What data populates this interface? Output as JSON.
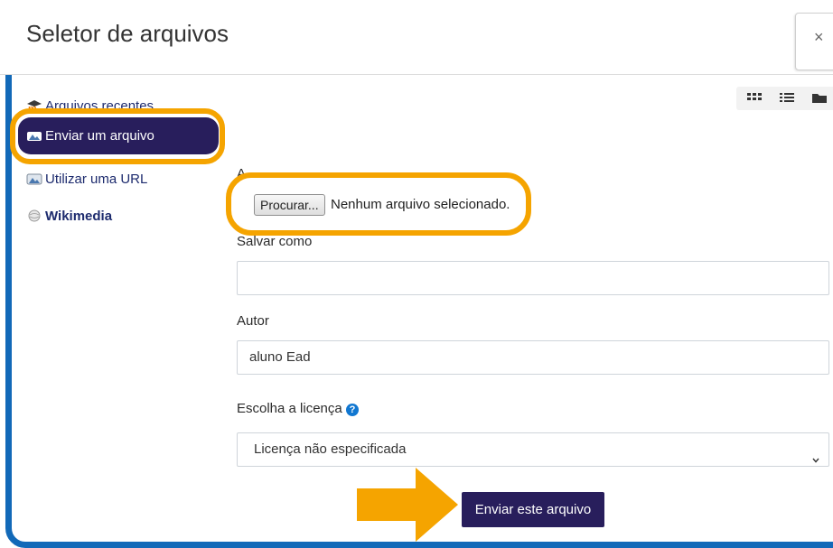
{
  "dialog": {
    "title": "Seletor de arquivos",
    "close_glyph": "×"
  },
  "sidebar": {
    "items": [
      {
        "label": "Arquivos recentes",
        "icon": "moodle-recent-icon"
      },
      {
        "label": "Enviar um arquivo",
        "icon": "upload-icon",
        "active": true
      },
      {
        "label": "Utilizar uma URL",
        "icon": "url-icon"
      },
      {
        "label": "Wikimedia",
        "icon": "wikimedia-icon"
      }
    ]
  },
  "view_modes": [
    "grid-view-icon",
    "list-view-icon",
    "folder-view-icon"
  ],
  "form": {
    "attachment_label_partial": "A",
    "browse_label": "Procurar...",
    "no_file_text": "Nenhum arquivo selecionado.",
    "save_as_label": "Salvar como",
    "save_as_value": "",
    "author_label": "Autor",
    "author_value": "aluno Ead",
    "license_label": "Escolha a licença",
    "help_glyph": "?",
    "license_value": "Licença não especificada",
    "submit_label": "Enviar este arquivo"
  },
  "colors": {
    "frame_border": "#1269b8",
    "highlight": "#f5a400",
    "primary": "#281e5c",
    "help": "#1177d1"
  }
}
